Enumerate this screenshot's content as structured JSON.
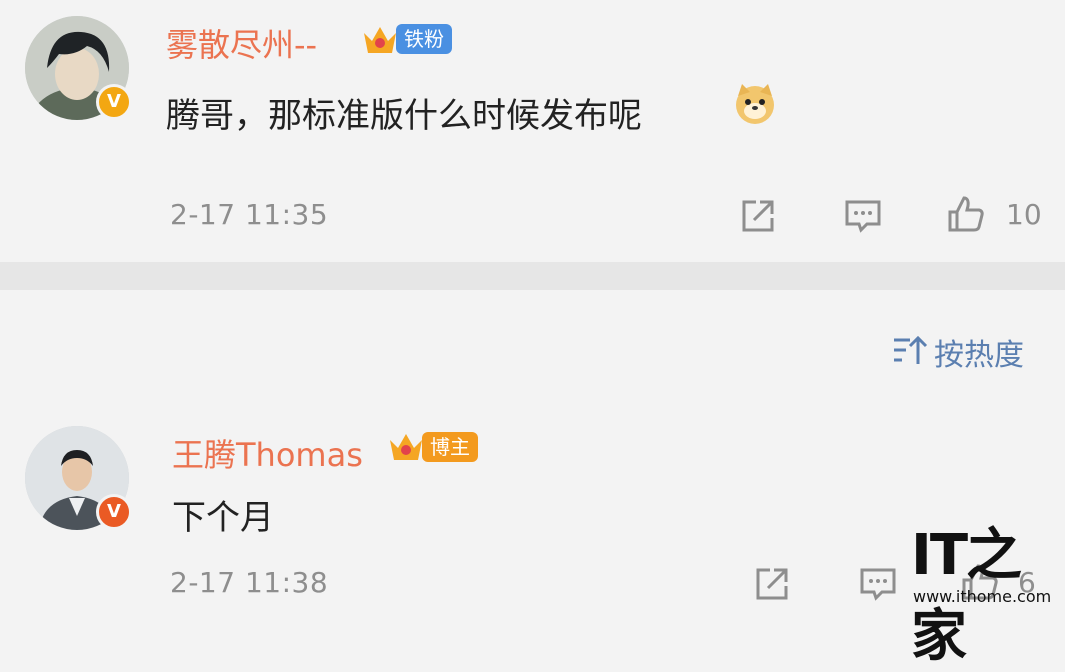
{
  "comments": [
    {
      "username": "雾散尽州--",
      "tag": "铁粉",
      "text": "腾哥，那标准版什么时候发布呢",
      "emoji": "doge-emoji",
      "time": "2-17 11:35",
      "likes": "10",
      "verified_badge": "V"
    },
    {
      "username": "王腾Thomas",
      "tag": "博主",
      "text": "下个月",
      "time": "2-17 11:38",
      "likes": "6",
      "verified_badge": "V"
    }
  ],
  "sort": {
    "label": "按热度"
  },
  "watermark": {
    "logo": "IT之家",
    "url": "www.ithome.com"
  },
  "colors": {
    "username": "#eb7350",
    "sort": "#5b7fb0",
    "tag_fan": "#4a90e2",
    "tag_host": "#f39a1e"
  },
  "icons": [
    "share-icon",
    "comment-icon",
    "like-icon",
    "sort-icon",
    "crown-icon"
  ]
}
